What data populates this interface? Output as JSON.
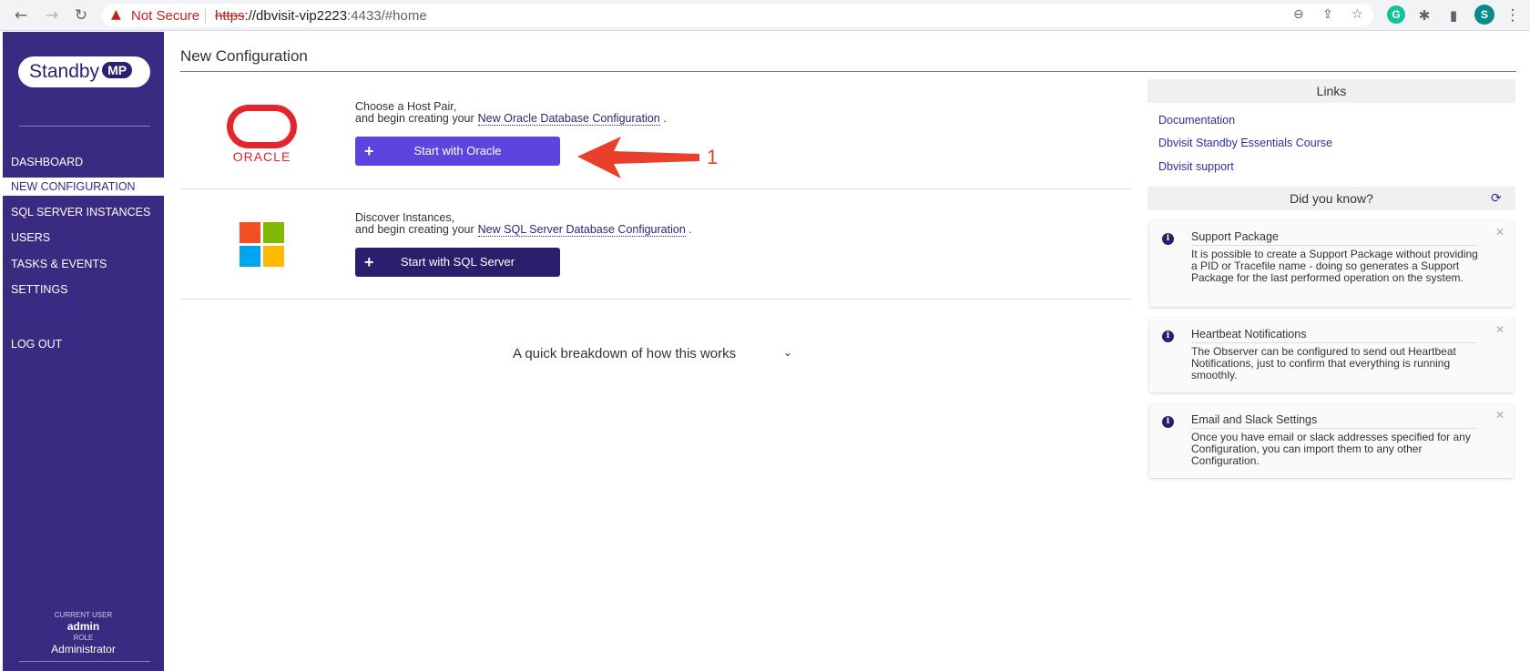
{
  "browser": {
    "not_secure": "Not Secure",
    "url_protocol": "https",
    "url_host": "://dbvisit-vip2223",
    "url_rest": ":4433/#home",
    "profile_initial": "S",
    "grammarly_initial": "G"
  },
  "sidebar": {
    "logo_text": "Standby",
    "logo_badge": "MP",
    "items": [
      {
        "label": "DASHBOARD"
      },
      {
        "label": "NEW CONFIGURATION"
      },
      {
        "label": "SQL SERVER INSTANCES"
      },
      {
        "label": "USERS"
      },
      {
        "label": "TASKS & EVENTS"
      },
      {
        "label": "SETTINGS"
      },
      {
        "label": "LOG OUT"
      }
    ],
    "current_user_label": "CURRENT USER",
    "current_user": "admin",
    "role_label": "ROLE",
    "role": "Administrator"
  },
  "main": {
    "title": "New Configuration",
    "oracle": {
      "logo_text": "ORACLE",
      "line1": "Choose a Host Pair,",
      "line2": "and begin creating your",
      "link": "New Oracle Database Configuration",
      "suffix": ".",
      "button": "Start with Oracle"
    },
    "sql": {
      "line1": "Discover Instances,",
      "line2": "and begin creating your",
      "link": "New SQL Server Database Configuration",
      "suffix": ".",
      "button": "Start with SQL Server"
    },
    "annotation_number": "1",
    "breakdown": "A quick breakdown of how this works"
  },
  "right": {
    "links_title": "Links",
    "links": [
      "Documentation",
      "Dbvisit Standby Essentials Course",
      "Dbvisit support"
    ],
    "dyk_title": "Did you know?",
    "tips": [
      {
        "title": "Support Package",
        "body": "It is possible to create a Support Package without providing a PID or Tracefile name - doing so generates a Support Package for the last performed operation on the system."
      },
      {
        "title": "Heartbeat Notifications",
        "body": "The Observer can be configured to send out Heartbeat Notifications, just to confirm that everything is running smoothly."
      },
      {
        "title": "Email and Slack Settings",
        "body": "Once you have email or slack addresses specified for any Configuration, you can import them to any other Configuration."
      }
    ]
  },
  "colors": {
    "sidebar_bg": "#3a2a82",
    "oracle_red": "#e3262b",
    "btn_oracle": "#5b45de",
    "btn_sql": "#2c1e6d",
    "arrow": "#e8402a"
  }
}
